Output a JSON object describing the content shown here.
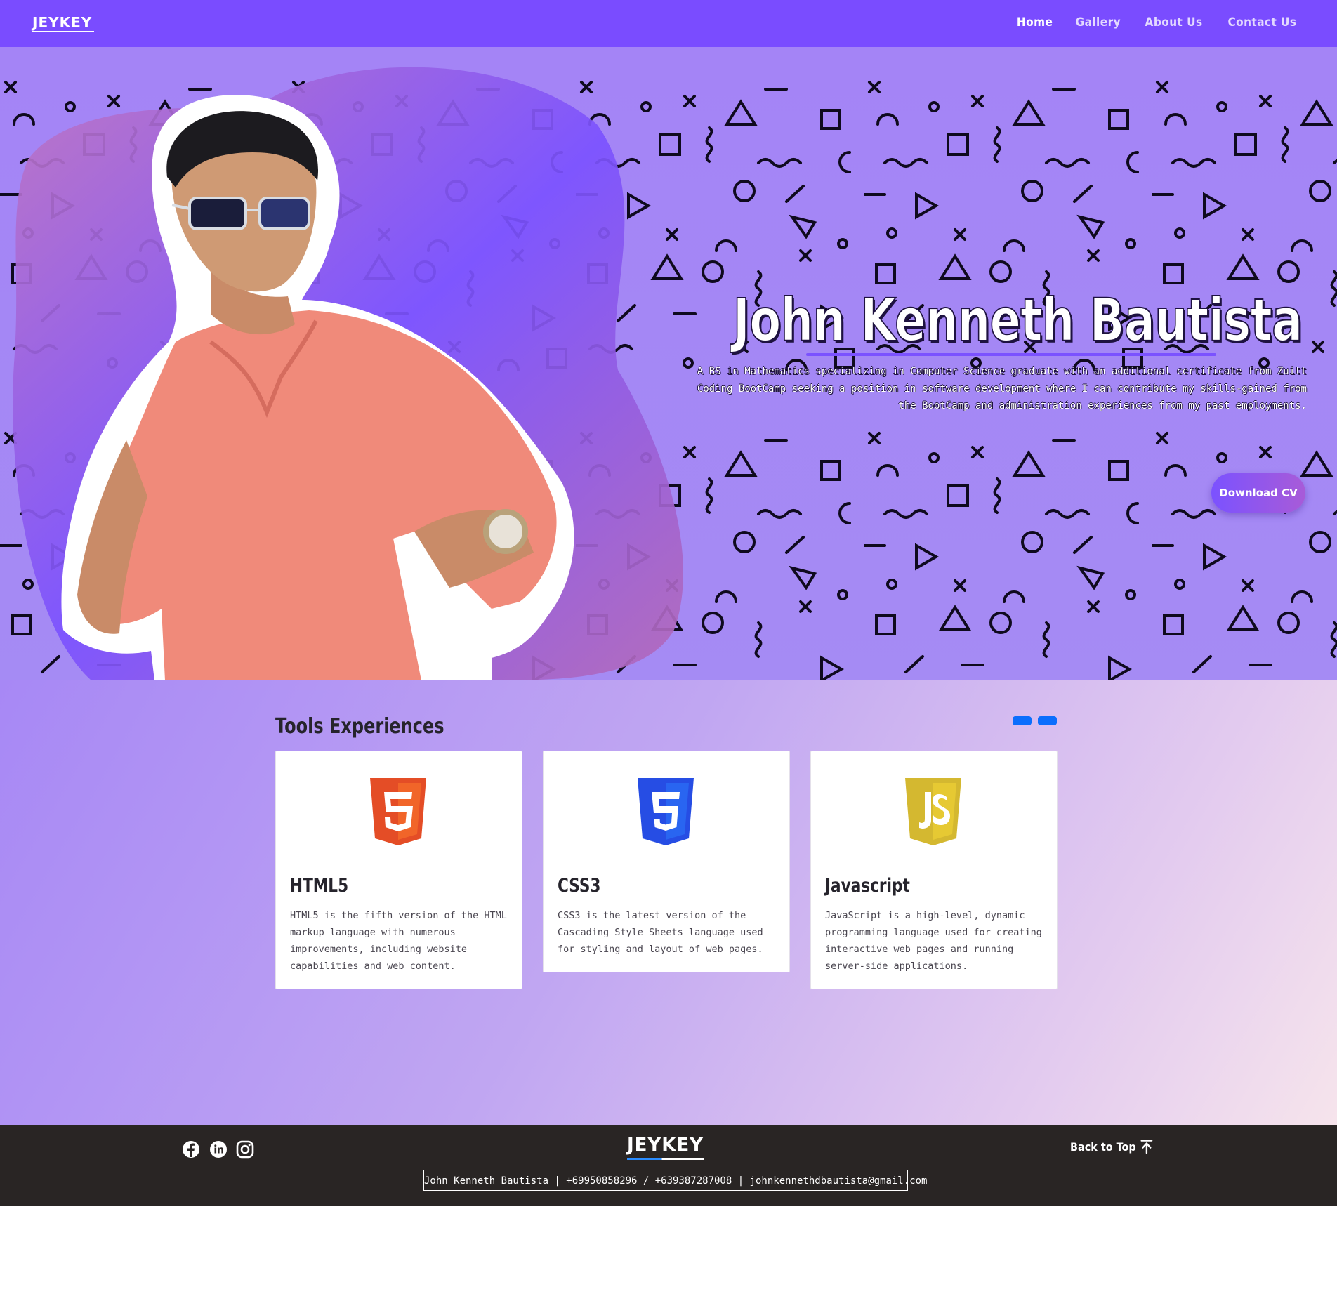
{
  "nav": {
    "brand": "JEYKEY",
    "links": [
      {
        "label": "Home",
        "active": true
      },
      {
        "label": "Gallery",
        "active": false
      },
      {
        "label": "About Us",
        "active": false
      },
      {
        "label": "Contact Us",
        "active": false
      }
    ]
  },
  "hero": {
    "name": "John Kenneth Bautista",
    "description": "A BS in Mathematics specializing in Computer Science graduate with an additional certificate from Zuitt Coding BootCamp seeking a position in software development where I can contribute my skills-gained from the BootCamp and administration experiences from my past employments.",
    "cta_label": "Download CV"
  },
  "tools": {
    "title": "Tools Experiences",
    "indicators": 2,
    "cards": [
      {
        "icon": "html5-icon",
        "title": "HTML5",
        "text": "HTML5 is the fifth version of the HTML markup language with numerous improvements, including website capabilities and web content."
      },
      {
        "icon": "css3-icon",
        "title": "CSS3",
        "text": "CSS3 is the latest version of the Cascading Style Sheets language used for styling and layout of web pages."
      },
      {
        "icon": "javascript-icon",
        "title": "Javascript",
        "text": "JavaScript is a high-level, dynamic programming language used for creating interactive web pages and running server-side applications."
      }
    ]
  },
  "footer": {
    "social": [
      "facebook-icon",
      "linkedin-icon",
      "instagram-icon"
    ],
    "brand": "JEYKEY",
    "back_to_top": "Back to Top",
    "contact": "John Kenneth Bautista | +69950858296 / +639387287008 | johnkennethdbautista@gmail.com"
  },
  "colors": {
    "nav_bg": "#7a4cff",
    "hero_bg": "#a484f6",
    "accent": "#7b52ff",
    "footer_bg": "#292524",
    "indicator": "#0b6efd"
  }
}
